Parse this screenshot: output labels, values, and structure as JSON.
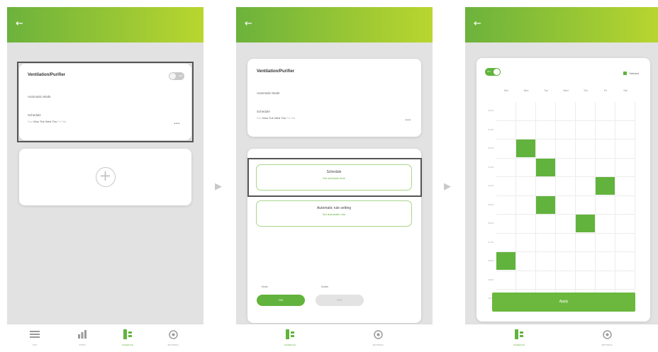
{
  "colors": {
    "accent": "#62b33d",
    "bar_start": "#6cb23c",
    "bar_end": "#b9d62f",
    "background": "#e2e2e2"
  },
  "screen1": {
    "back_icon": "arrow-left-icon",
    "card": {
      "title": "Ventilation/Purifier",
      "toggle_label": "OFF",
      "mode": "Automatic Mode",
      "schedule_label": "Schedule",
      "days": [
        {
          "label": "Sun",
          "active": false
        },
        {
          "label": "Mon",
          "active": true
        },
        {
          "label": "Tue",
          "active": true
        },
        {
          "label": "Wed",
          "active": true
        },
        {
          "label": "Thu",
          "active": true
        },
        {
          "label": "Fri",
          "active": false
        },
        {
          "label": "Sat",
          "active": false
        }
      ]
    },
    "add_icon": "plus-circle-icon",
    "nav": [
      {
        "icon": "list-icon",
        "label": "LIST",
        "active": false
      },
      {
        "icon": "chart-icon",
        "label": "STATS",
        "active": false
      },
      {
        "icon": "schedule-icon",
        "label": "SCHEDULE",
        "active": true
      },
      {
        "icon": "settings-icon",
        "label": "SETTINGS",
        "active": false
      }
    ]
  },
  "screen2": {
    "card": {
      "title": "Ventilation/Purifier",
      "mode": "Automatic Mode",
      "schedule_label": "Schedule",
      "days": [
        {
          "label": "Sun",
          "active": false
        },
        {
          "label": "Mon",
          "active": true
        },
        {
          "label": "Tue",
          "active": true
        },
        {
          "label": "Wed",
          "active": true
        },
        {
          "label": "Thu",
          "active": true
        },
        {
          "label": "Fri",
          "active": false
        },
        {
          "label": "Sat",
          "active": false
        }
      ]
    },
    "options": [
      {
        "title": "Schedule",
        "subtitle": "Set schedule time"
      },
      {
        "title": "Automatic rule setting",
        "subtitle": "Set automatic rule"
      }
    ],
    "buttons": [
      {
        "caption": "Mode",
        "label": "ON",
        "active": true
      },
      {
        "caption": "Switch",
        "label": "OFF",
        "active": false
      }
    ],
    "nav": [
      {
        "icon": "schedule-icon",
        "label": "SCHEDULE",
        "active": true
      },
      {
        "icon": "settings-icon",
        "label": "SETTINGS",
        "active": false
      }
    ]
  },
  "screen3": {
    "toggle_label": "ON",
    "legend_label": "Selected",
    "days": [
      "Sun",
      "Mon",
      "Tue",
      "Wed",
      "Thu",
      "Fri",
      "Sat"
    ],
    "times": [
      "00:00",
      "01:00",
      "02:00",
      "03:00",
      "04:00",
      "05:00",
      "06:00",
      "07:00",
      "08:00",
      "09:00",
      "10:00"
    ],
    "selected": [
      {
        "day": 1,
        "slot": 2
      },
      {
        "day": 2,
        "slot": 3
      },
      {
        "day": 5,
        "slot": 4
      },
      {
        "day": 2,
        "slot": 5
      },
      {
        "day": 4,
        "slot": 6
      },
      {
        "day": 0,
        "slot": 8
      }
    ],
    "apply_label": "Apply",
    "nav": [
      {
        "icon": "schedule-icon",
        "label": "SCHEDULE",
        "active": true
      },
      {
        "icon": "settings-icon",
        "label": "SETTINGS",
        "active": false
      }
    ]
  },
  "arrows": [
    "arrow-right-icon",
    "arrow-right-icon"
  ]
}
